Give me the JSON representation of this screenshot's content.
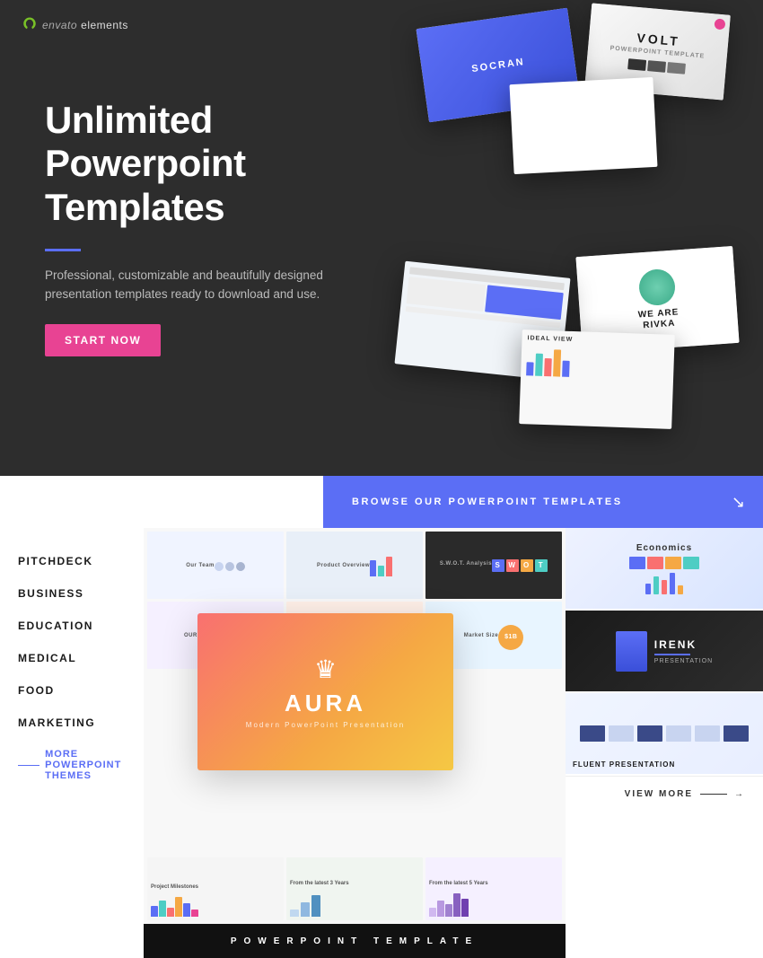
{
  "hero": {
    "logo": "envato elements",
    "logo_brand": "envato",
    "logo_product": "elements",
    "title": "Unlimited Powerpoint Templates",
    "subtitle": "Professional, customizable and beautifully designed presentation templates ready to download and use.",
    "cta_label": "START NOW"
  },
  "browse": {
    "header_label": "BROWSE OUR POWERPOINT TEMPLATES",
    "view_more_label": "VIEW MORE"
  },
  "nav": {
    "items": [
      {
        "label": "PITCHDECK",
        "id": "pitchdeck"
      },
      {
        "label": "BUSINESS",
        "id": "business"
      },
      {
        "label": "EDUCATION",
        "id": "education"
      },
      {
        "label": "MEDICAL",
        "id": "medical"
      },
      {
        "label": "FOOD",
        "id": "food"
      },
      {
        "label": "MARKETING",
        "id": "marketing"
      },
      {
        "label": "MORE POWERPOINT THEMES",
        "id": "more"
      }
    ]
  },
  "featured": {
    "aura_title": "AURA",
    "aura_subtitle": "Modern PowerPoint Presentation"
  },
  "slides": {
    "volt_title": "VOLT",
    "socran_title": "SOCRAN",
    "rivka_line1": "WE ARE",
    "rivka_line2": "RIVKA"
  },
  "thumbnails": [
    {
      "label": "Economics",
      "type": "economics"
    },
    {
      "label": "IRENK",
      "type": "irenk"
    },
    {
      "label": "FLUENT PRESENTATION",
      "type": "fluent"
    }
  ],
  "banner": {
    "text": "POWERPOINT TEMPLATE"
  },
  "colors": {
    "accent_blue": "#5b6ef5",
    "accent_pink": "#e84393",
    "hero_bg": "#2d2d2d",
    "dark_text": "#1a1a1a"
  }
}
